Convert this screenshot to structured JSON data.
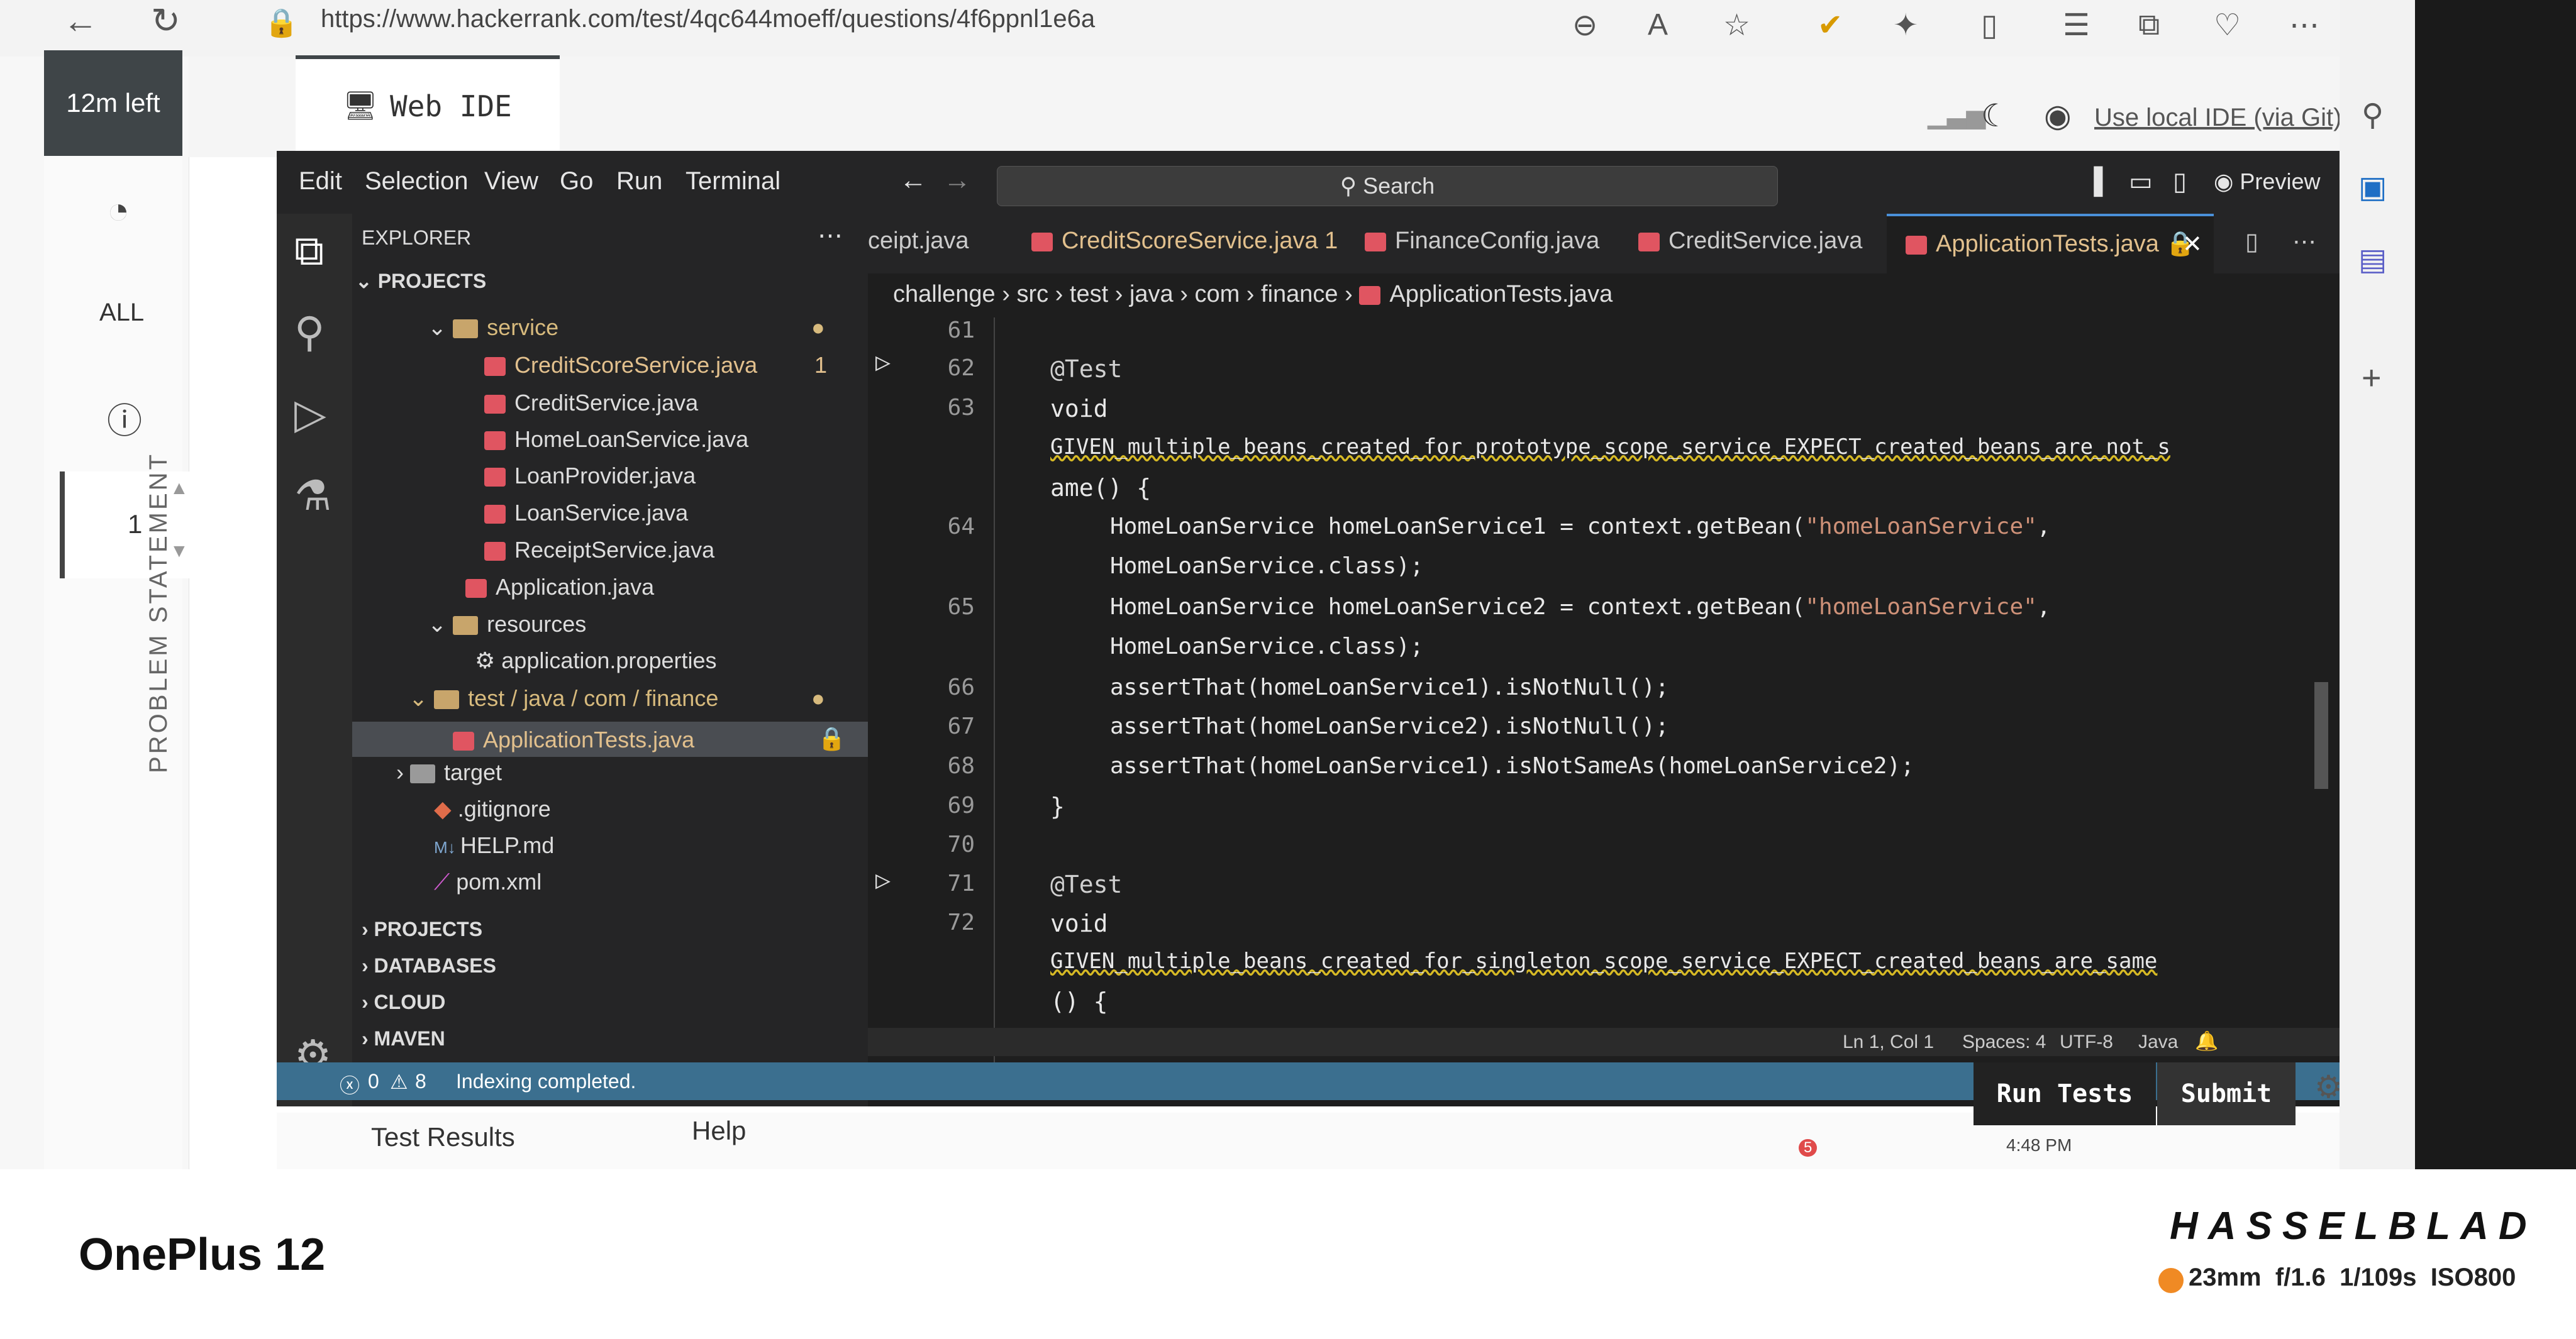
{
  "browser": {
    "url": "https://www.hackerrank.com/test/4qc644moeff/questions/4f6ppnl1e6a"
  },
  "hackerrank": {
    "timer": "12m left",
    "all_label": "ALL",
    "question_number": "1",
    "problem_statement": "PROBLEM STATEMENT",
    "web_ide_tab": "Web IDE",
    "use_local_ide": "Use local IDE (via Git)",
    "run_tests": "Run Tests",
    "submit": "Submit",
    "test_results": "Test Results",
    "help": "Help",
    "clock": "4:48 PM",
    "badge": "5"
  },
  "vscode": {
    "menu": [
      "Edit",
      "Selection",
      "View",
      "Go",
      "Run",
      "Terminal"
    ],
    "search": "Search",
    "preview": "Preview",
    "explorer_title": "EXPLORER",
    "projects_header": "PROJECTS",
    "tree": [
      {
        "label": "service",
        "badge": "●"
      },
      {
        "label": "CreditScoreService.java",
        "badge": "1"
      },
      {
        "label": "CreditService.java"
      },
      {
        "label": "HomeLoanService.java"
      },
      {
        "label": "LoanProvider.java"
      },
      {
        "label": "LoanService.java"
      },
      {
        "label": "ReceiptService.java"
      },
      {
        "label": "Application.java"
      },
      {
        "label": "resources"
      },
      {
        "label": "application.properties"
      },
      {
        "label": "test / java / com / finance",
        "badge": "●"
      },
      {
        "label": "ApplicationTests.java"
      },
      {
        "label": "target"
      },
      {
        "label": ".gitignore"
      },
      {
        "label": "HELP.md"
      },
      {
        "label": "pom.xml"
      }
    ],
    "sections": [
      "PROJECTS",
      "DATABASES",
      "CLOUD",
      "MAVEN"
    ],
    "tabs": [
      {
        "label": "ceipt.java"
      },
      {
        "label": "CreditScoreService.java 1"
      },
      {
        "label": "FinanceConfig.java"
      },
      {
        "label": "CreditService.java"
      },
      {
        "label": "ApplicationTests.java"
      }
    ],
    "breadcrumb": [
      "challenge",
      "src",
      "test",
      "java",
      "com",
      "finance",
      "ApplicationTests.java"
    ],
    "lines": [
      {
        "n": "61",
        "code": ""
      },
      {
        "n": "62",
        "code": "@Test"
      },
      {
        "n": "63",
        "code": "void"
      },
      {
        "n": "",
        "code": "GIVEN_multiple_beans_created_for_prototype_scope_service_EXPECT_created_beans_are_not_s"
      },
      {
        "n": "",
        "code": "ame() {"
      },
      {
        "n": "64",
        "code": "HomeLoanService homeLoanService1 = context.getBean(",
        "str": "\"homeLoanService\"",
        "tail": ","
      },
      {
        "n": "",
        "code": "HomeLoanService.class);"
      },
      {
        "n": "65",
        "code": "HomeLoanService homeLoanService2 = context.getBean(",
        "str": "\"homeLoanService\"",
        "tail": ","
      },
      {
        "n": "",
        "code": "HomeLoanService.class);"
      },
      {
        "n": "66",
        "code": "assertThat(homeLoanService1).isNotNull();"
      },
      {
        "n": "67",
        "code": "assertThat(homeLoanService2).isNotNull();"
      },
      {
        "n": "68",
        "code": "assertThat(homeLoanService1).isNotSameAs(homeLoanService2);"
      },
      {
        "n": "69",
        "code": "}"
      },
      {
        "n": "70",
        "code": ""
      },
      {
        "n": "71",
        "code": "@Test"
      },
      {
        "n": "72",
        "code": "void"
      },
      {
        "n": "",
        "code": "GIVEN_multiple_beans_created_for_singleton_scope_service_EXPECT_created_beans_are_same"
      },
      {
        "n": "",
        "code": "() {"
      }
    ],
    "status_right": [
      "Ln 1, Col 1",
      "Spaces: 4",
      "UTF-8",
      "Java"
    ],
    "errors": "0",
    "warnings": "8",
    "status_message": "Indexing completed."
  },
  "watermark": {
    "phone": "OnePlus 12",
    "brand": "HASSELBLAD",
    "exif": "23mm  f/1.6  1/109s  ISO800"
  }
}
